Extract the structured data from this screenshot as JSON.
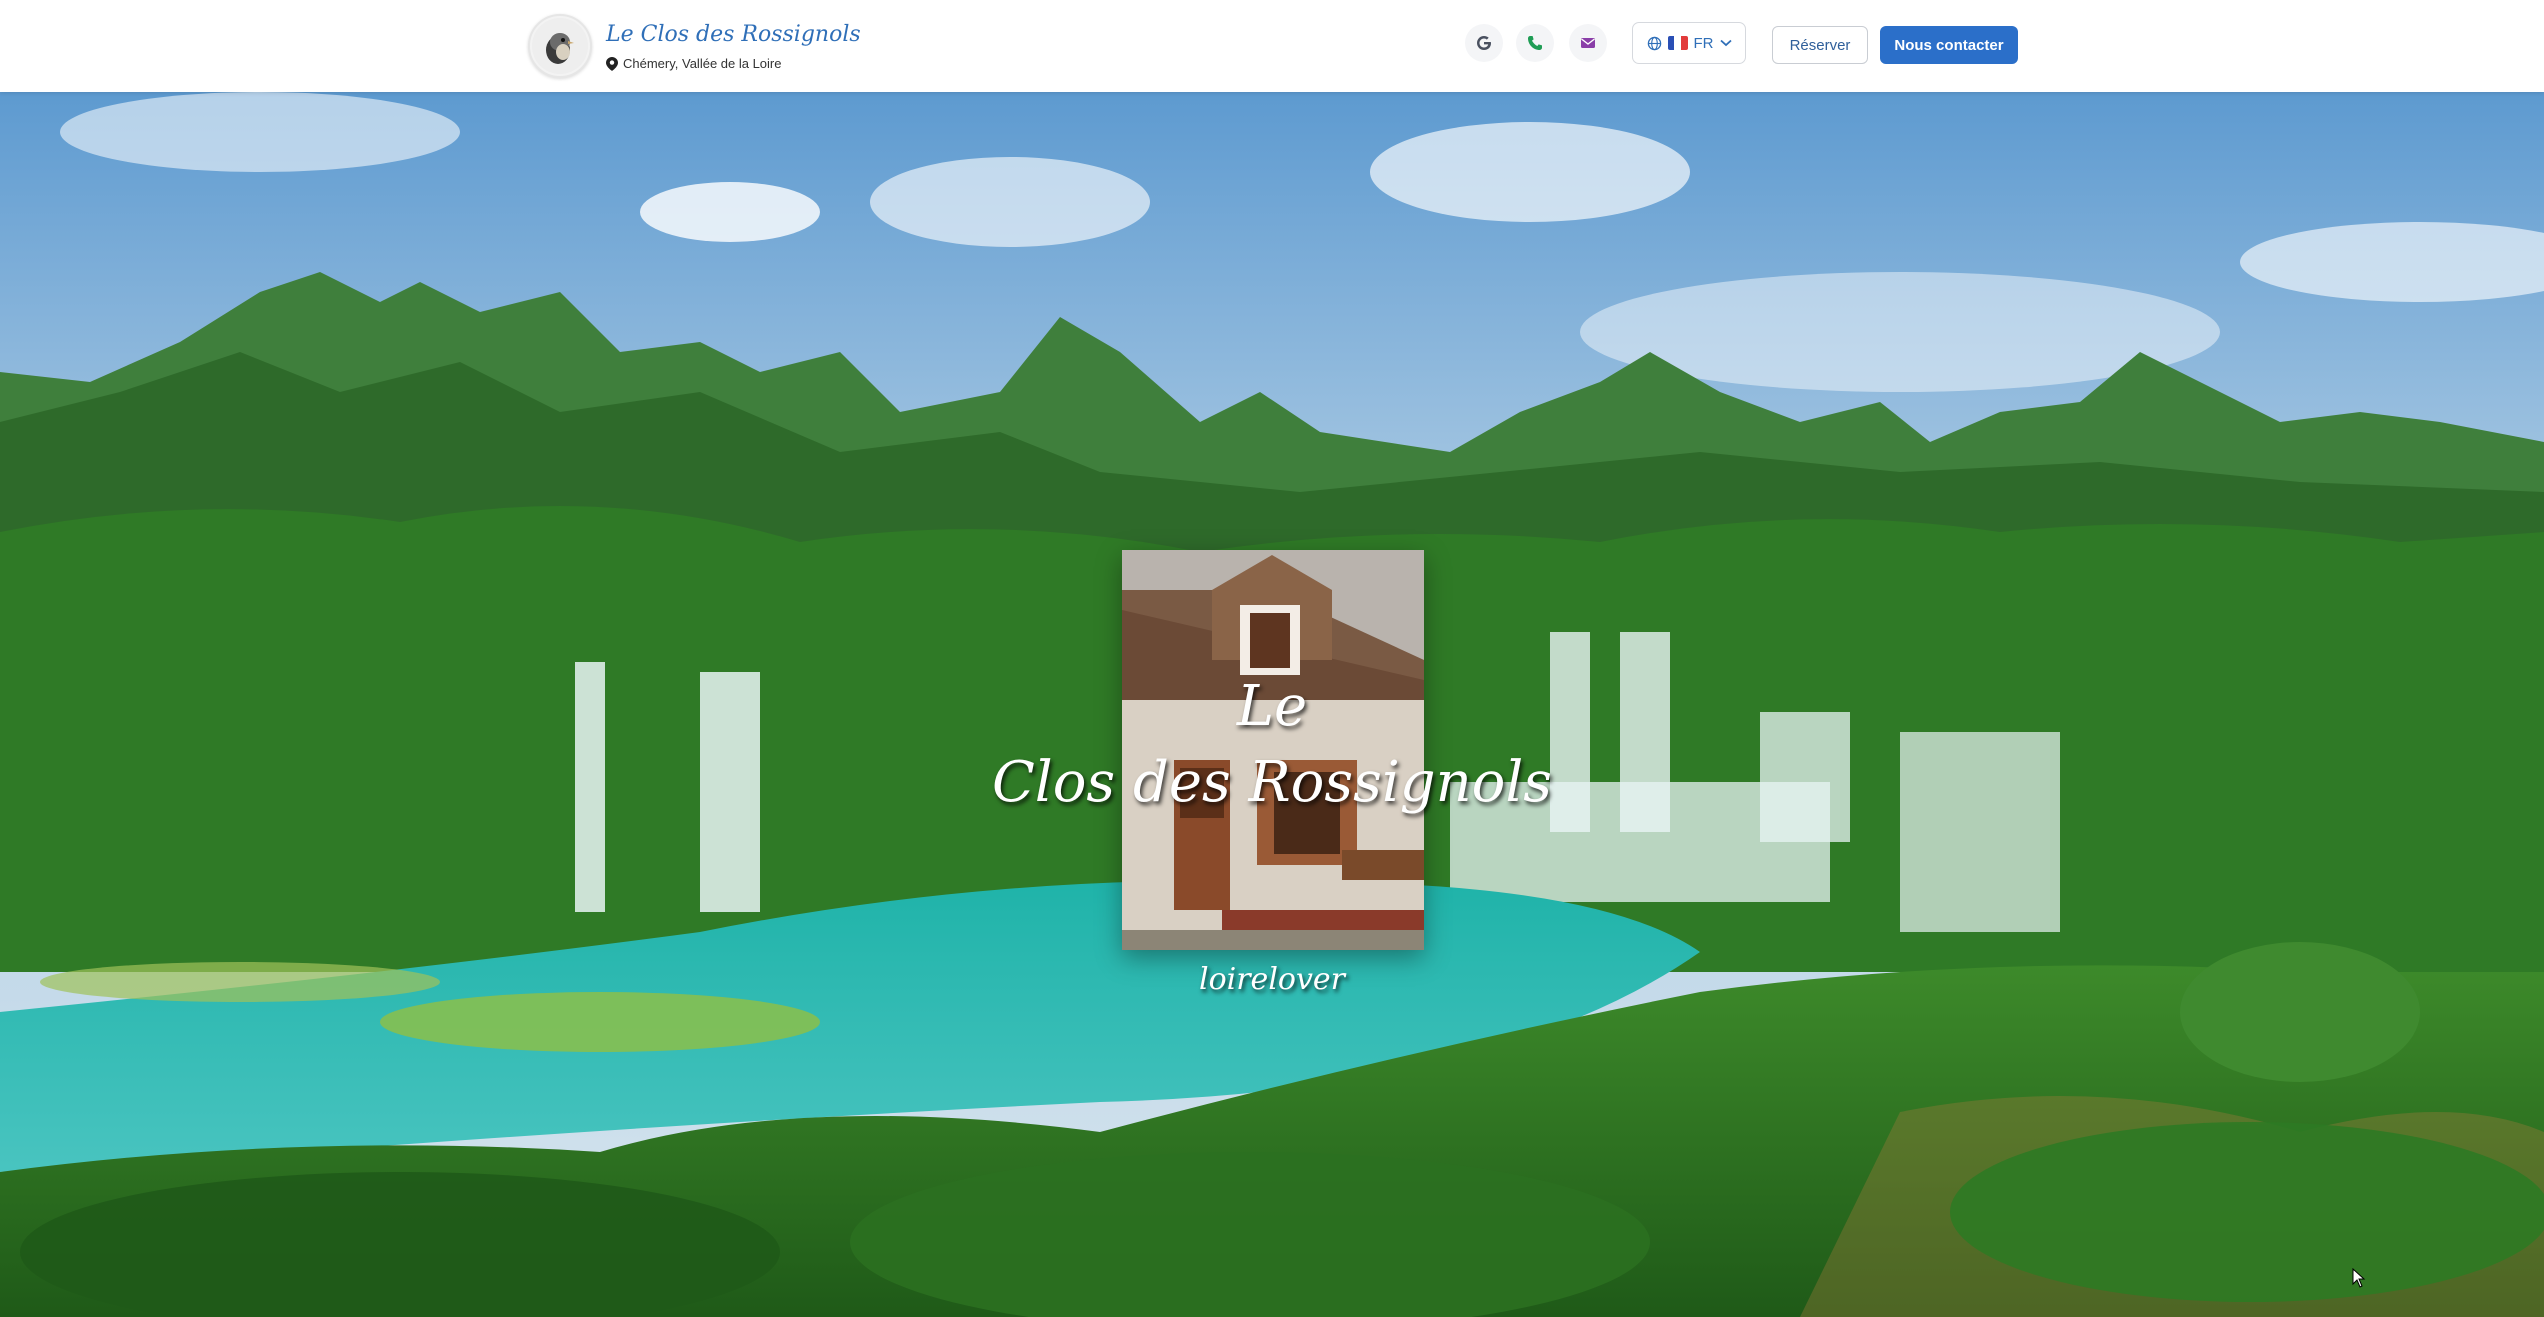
{
  "header": {
    "brand_name": "Le Clos des Rossignols",
    "location": "Chémery, Vallée de la Loire",
    "icons": {
      "google": "google-icon",
      "phone": "phone-icon",
      "email": "mail-icon",
      "globe": "globe-icon",
      "chevron": "chevron-down-icon",
      "pin": "map-pin-icon"
    },
    "language": {
      "code": "FR",
      "flag": "france-flag"
    },
    "reserve_label": "Réserver",
    "contact_label": "Nous contacter"
  },
  "hero": {
    "title_line1": "Le",
    "title_line2": "Clos des Rossignols",
    "tagline": "loirelover"
  },
  "colors": {
    "primary": "#2b6fc9",
    "brand_text": "#2f6fb8",
    "google_icon": "#4a5160",
    "phone_icon": "#1f9d55",
    "mail_icon": "#8a3ea8"
  }
}
